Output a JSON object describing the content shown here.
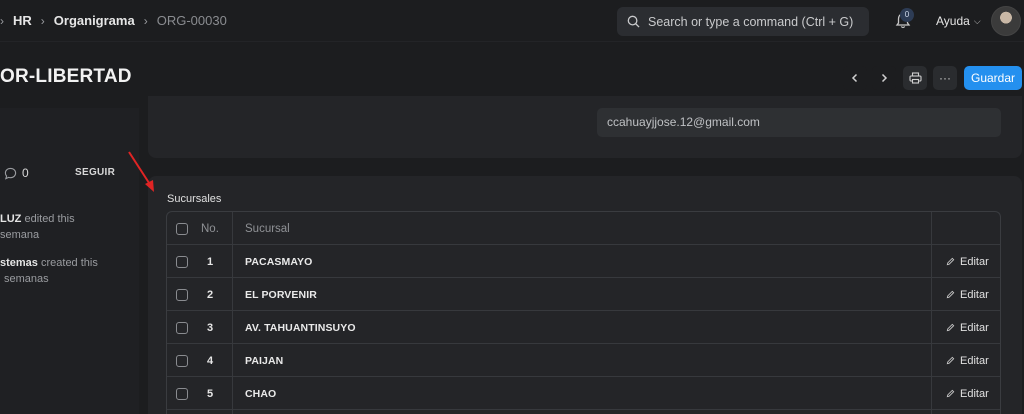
{
  "breadcrumb": {
    "items": [
      "HR",
      "Organigrama",
      "ORG-00030"
    ]
  },
  "search": {
    "placeholder": "Search or type a command (Ctrl + G)"
  },
  "notifications": {
    "count": "0"
  },
  "help": {
    "label": "Ayuda"
  },
  "page": {
    "title": "OR-LIBERTAD"
  },
  "actions": {
    "save_label": "Guardar"
  },
  "sidebar": {
    "comments_count": "0",
    "follow_label": "SEGUIR",
    "activity": [
      {
        "user": "LUZ",
        "text": "edited this",
        "time": "semana"
      },
      {
        "user": "stemas",
        "text": "created this",
        "time": "semanas"
      }
    ]
  },
  "form": {
    "email_value": "ccahuayjjose.12@gmail.com"
  },
  "table": {
    "section_label": "Sucursales",
    "columns": [
      "No.",
      "Sucursal"
    ],
    "edit_label": "Editar",
    "rows": [
      {
        "no": "1",
        "sucursal": "PACASMAYO"
      },
      {
        "no": "2",
        "sucursal": "EL PORVENIR"
      },
      {
        "no": "3",
        "sucursal": "AV. TAHUANTINSUYO"
      },
      {
        "no": "4",
        "sucursal": "PAIJAN"
      },
      {
        "no": "5",
        "sucursal": "CHAO"
      }
    ]
  },
  "colors": {
    "accent": "#2490ef",
    "annotation_arrow": "#e02424",
    "background": "#1c1d1f",
    "panel": "#242528"
  }
}
